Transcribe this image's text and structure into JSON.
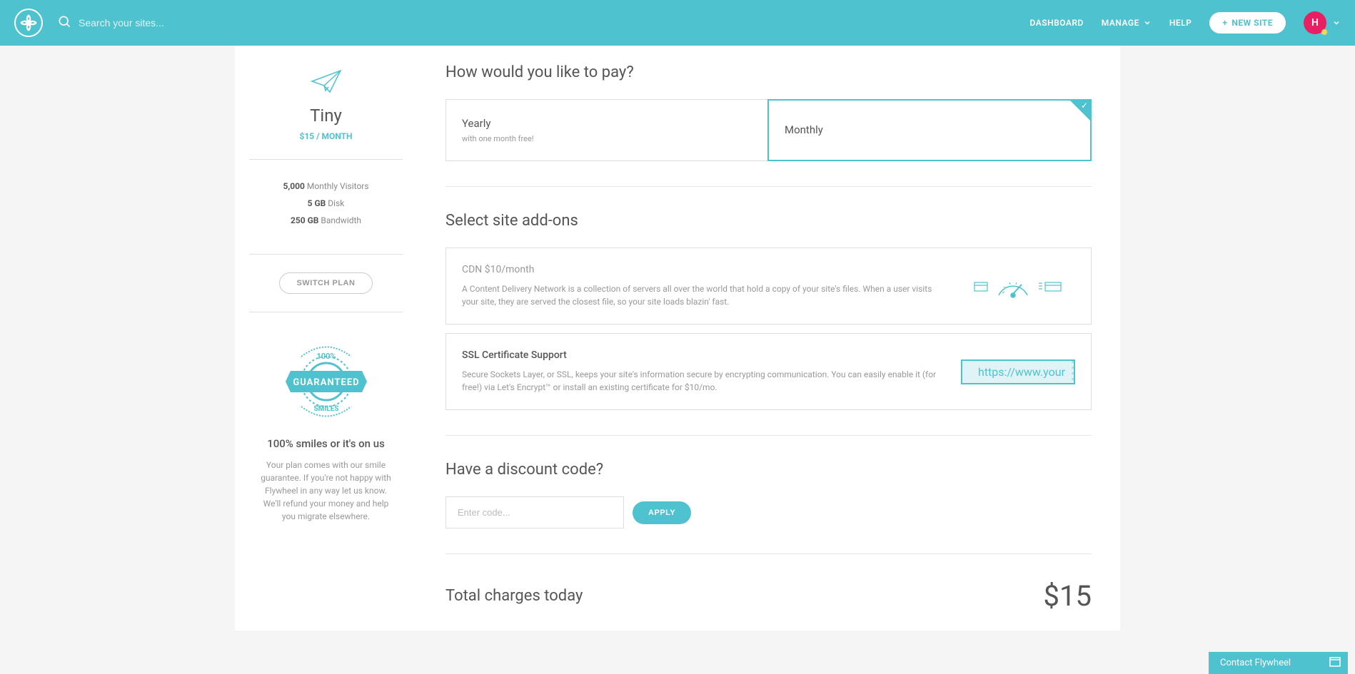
{
  "header": {
    "search_placeholder": "Search your sites...",
    "nav_dashboard": "DASHBOARD",
    "nav_manage": "MANAGE",
    "nav_help": "HELP",
    "new_site": "NEW SITE",
    "avatar_initial": "H"
  },
  "sidebar": {
    "plan_name": "Tiny",
    "plan_price": "$15 / MONTH",
    "spec_visitors_val": "5,000",
    "spec_visitors_label": " Monthly Visitors",
    "spec_disk_val": "5 GB",
    "spec_disk_label": " Disk",
    "spec_bandwidth_val": "250 GB",
    "spec_bandwidth_label": " Bandwidth",
    "switch_plan": "SWITCH PLAN",
    "guarantee_title": "100% smiles or it's on us",
    "guarantee_text": "Your plan comes with our smile guarantee. If you're not happy with Flywheel in any way let us know. We'll refund your money and help you migrate elsewhere."
  },
  "main": {
    "pay_title": "How would you like to pay?",
    "pay_yearly_title": "Yearly",
    "pay_yearly_sub": "with one month free!",
    "pay_monthly_title": "Monthly",
    "addons_title": "Select site add-ons",
    "cdn_title": "CDN ",
    "cdn_price": "$10/month",
    "cdn_desc": "A Content Delivery Network is a collection of servers all over the world that hold a copy of your site's files. When a user visits your site, they are served the closest file, so your site loads blazin' fast.",
    "ssl_title": "SSL Certificate Support",
    "ssl_desc": "Secure Sockets Layer, or SSL, keeps your site's information secure by encrypting communication. You can easily enable it (for free!) via Let's Encrypt™ or install an existing certificate for $10/mo.",
    "ssl_url": "https://www.your",
    "discount_title": "Have a discount code?",
    "discount_placeholder": "Enter code...",
    "apply_label": "APPLY",
    "total_label": "Total charges today",
    "total_amount": "$15"
  },
  "contact": {
    "label": "Contact Flywheel"
  }
}
